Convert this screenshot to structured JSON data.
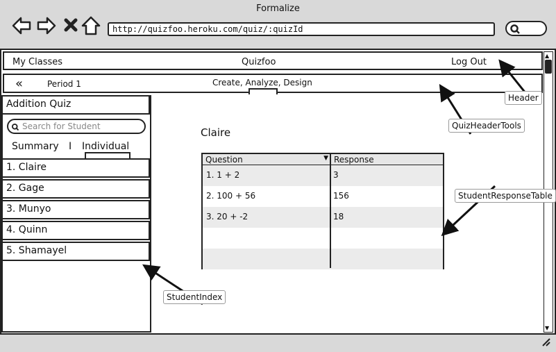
{
  "window": {
    "title": "Formalize",
    "url": "http://quizfoo.heroku.com/quiz/:quizId"
  },
  "header": {
    "my_classes": "My Classes",
    "app_name": "Quizfoo",
    "log_out": "Log Out"
  },
  "quiz_header_tools": {
    "back_icon": "double-chevron-left-icon",
    "period": "Period 1",
    "menu": "Create, Analyze, Design"
  },
  "sidebar": {
    "quiz_title": "Addition Quiz",
    "search_placeholder": "Search for Student",
    "tabs": {
      "summary": "Summary",
      "separator": "I",
      "individual": "Individual"
    },
    "students": [
      "1. Claire",
      "2. Gage",
      "3. Munyo",
      "4. Quinn",
      "5. Shamayel"
    ]
  },
  "content": {
    "student_name": "Claire",
    "table": {
      "headers": [
        "Question",
        "Response"
      ],
      "rows": [
        [
          "1. 1 + 2",
          "3"
        ],
        [
          "2. 100 + 56",
          "156"
        ],
        [
          "3. 20 + -2",
          "18"
        ],
        [
          "",
          ""
        ],
        [
          "",
          ""
        ]
      ]
    }
  },
  "annotations": {
    "header": "Header",
    "quiz_header_tools": "QuizHeaderTools",
    "student_response_table": "StudentResponseTable",
    "student_index": "StudentIndex"
  }
}
